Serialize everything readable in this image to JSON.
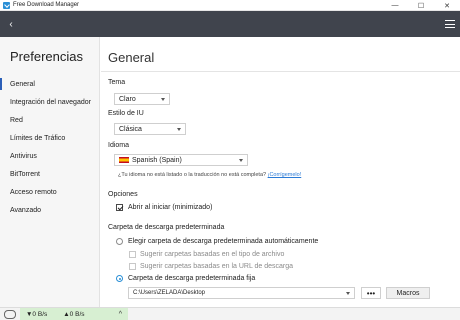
{
  "window": {
    "title": "Free Download Manager",
    "minimize": "—",
    "maximize": "☐",
    "close": "✕"
  },
  "toolbar": {
    "back": "‹"
  },
  "sidebar": {
    "title": "Preferencias",
    "items": [
      {
        "label": "General",
        "active": true
      },
      {
        "label": "Integración del navegador"
      },
      {
        "label": "Red"
      },
      {
        "label": "Límites de Tráfico"
      },
      {
        "label": "Antivirus"
      },
      {
        "label": "BitTorrent"
      },
      {
        "label": "Acceso remoto"
      },
      {
        "label": "Avanzado"
      }
    ]
  },
  "main": {
    "title": "General",
    "theme": {
      "label": "Tema",
      "value": "Claro"
    },
    "ui_style": {
      "label": "Estilo de IU",
      "value": "Clásica"
    },
    "language": {
      "label": "Idioma",
      "value": "Spanish (Spain)",
      "hint": "¿Tu idioma no está listado o la traducción no está completa?",
      "hint_link": "¡Corrígemelo!"
    },
    "options": {
      "label": "Opciones",
      "start_minimized": {
        "label": "Abrir al iniciar (minimizado)",
        "checked": true
      }
    },
    "download_folder": {
      "label": "Carpeta de descarga predeterminada",
      "auto": {
        "label": "Elegir carpeta de descarga predeterminada automáticamente",
        "checked": false
      },
      "by_file_type": {
        "label": "Sugerir carpetas basadas en el tipo de archivo",
        "checked": false
      },
      "by_url": {
        "label": "Sugerir carpetas basadas en la URL de descarga",
        "checked": false
      },
      "fixed": {
        "label": "Carpeta de descarga predeterminada fija",
        "checked": true
      },
      "path": "C:\\Users\\ZELADA\\Desktop",
      "browse": "•••",
      "macros": "Macros"
    }
  },
  "statusbar": {
    "download_speed": "▼0 B/s",
    "upload_speed": "▲0 B/s",
    "expand": "^"
  }
}
